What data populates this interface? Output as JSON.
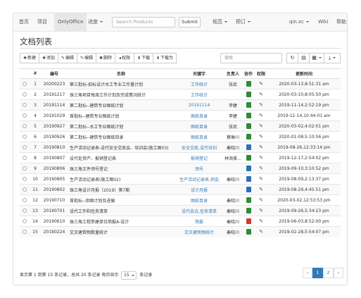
{
  "navbar": {
    "items": [
      {
        "label": "首页",
        "dropdown": false
      },
      {
        "label": "项目",
        "dropdown": false
      },
      {
        "label": "OnlyOffice",
        "dropdown": false,
        "active": true
      },
      {
        "label": "进度",
        "dropdown": true
      }
    ],
    "search_placeholder": "Search Products",
    "submit_label": "Submit",
    "right_items": [
      {
        "label": "规范",
        "dropdown": true
      },
      {
        "label": "预订",
        "dropdown": true
      },
      {
        "label": "qin.xc",
        "dropdown": true
      },
      {
        "label": "Wiki",
        "dropdown": false
      },
      {
        "label": "帮助",
        "dropdown": false
      }
    ]
  },
  "page": {
    "title": "文档列表"
  },
  "toolbar": {
    "buttons": [
      {
        "icon": "plus-icon",
        "glyph": "✚",
        "label": "新建"
      },
      {
        "icon": "plus-icon",
        "glyph": "✚",
        "label": "添加"
      },
      {
        "icon": "edit-icon",
        "glyph": "✎",
        "label": "编辑"
      },
      {
        "icon": "edit-icon",
        "glyph": "✎",
        "label": "编辑"
      },
      {
        "icon": "trash-icon",
        "glyph": "✖",
        "label": "删除"
      },
      {
        "icon": "share-icon",
        "glyph": "◂",
        "label": "权限"
      },
      {
        "icon": "download-icon",
        "glyph": "⬇",
        "label": "下载"
      },
      {
        "icon": "download-icon",
        "glyph": "⬇",
        "label": "下载为"
      }
    ],
    "filter_placeholder": "搜索",
    "right_buttons": [
      {
        "icon": "refresh-icon",
        "glyph": "↻"
      },
      {
        "icon": "columns-icon",
        "glyph": "▤"
      },
      {
        "icon": "grid-icon",
        "glyph": "▦",
        "dropdown": true
      },
      {
        "icon": "export-icon",
        "glyph": "⤓",
        "dropdown": true
      }
    ]
  },
  "table": {
    "headers": [
      "",
      "#",
      "编号",
      "名称",
      "关键字",
      "负责人",
      "协作",
      "权限",
      "更新时间"
    ],
    "rows": [
      {
        "index": "1",
        "code": "20200223",
        "name": "第三批标-招标设计水工专业工作量计划",
        "keyword": "工作统计",
        "owner": "张武",
        "filetype": "excel",
        "updated": "2020-03-13,8:51:31 am"
      },
      {
        "index": "2",
        "code": "20191217",
        "name": "珠三角项目每周工作计划及完成情况统计",
        "keyword": "工作统计",
        "owner": "",
        "filetype": "excel",
        "updated": "2020-03-10,8:05:50 pm"
      },
      {
        "index": "3",
        "code": "20191114",
        "name": "第二批标--建筑专业图纸计划",
        "keyword": "20191114",
        "owner": "李婕",
        "filetype": "excel",
        "updated": "2019-11-14,2:52:19 pm"
      },
      {
        "index": "4",
        "code": "20191029",
        "name": "首批标--建筑专业图纸计划",
        "keyword": "图纸目录",
        "owner": "李婕",
        "filetype": "excel",
        "updated": "2019-11-14,10:44:01 am"
      },
      {
        "index": "5",
        "code": "20190927",
        "name": "第二批标--水工专业图纸计划",
        "keyword": "图纸目录",
        "owner": "张武",
        "filetype": "excel",
        "updated": "2020-03-02,4:02:01 pm"
      },
      {
        "index": "6",
        "code": "20190926",
        "name": "第二批标--建筑专业图纸目录",
        "keyword": "图纸目录",
        "owner": "蔡琳川",
        "filetype": "excel",
        "updated": "2020-01-08,5:10:56 pm"
      },
      {
        "index": "7",
        "code": "20190810",
        "name": "生产活动记录表-设代安全交底会、培训会(施工图03)",
        "keyword": "安全交底,设代培训",
        "owner": "秦晓川",
        "filetype": "word",
        "updated": "2019-08-26,12:33:14 pm"
      },
      {
        "index": "8",
        "code": "20190807",
        "name": "设代处资产、报销登记表",
        "keyword": "报销登记",
        "owner": "林海美...",
        "filetype": "excel",
        "updated": "2019-12-17,2:54:02 pm"
      },
      {
        "index": "9",
        "code": "20190806",
        "name": "珠三角文件领号登记",
        "keyword": "领号",
        "owner": "",
        "filetype": "word",
        "updated": "2019-09-10,3:10:52 pm"
      },
      {
        "index": "10",
        "code": "20190805",
        "name": "生产活动记录表(施工图02)",
        "keyword": "生产活动记录表,例会",
        "owner": "秦晓川",
        "filetype": "word",
        "updated": "2019-08-09,2:13:37 pm"
      },
      {
        "index": "11",
        "code": "20190802",
        "name": "珠三角设计月报（2019）第7期",
        "keyword": "设计月报",
        "owner": "",
        "filetype": "word",
        "updated": "2019-08-29,4:45:51 pm"
      },
      {
        "index": "12",
        "code": "20190710",
        "name": "首批标--供图计划及进展",
        "keyword": "图纸目录",
        "owner": "秦晓川",
        "filetype": "excel",
        "updated": "2020-03-02,12:53:53 pm"
      },
      {
        "index": "13",
        "code": "20190701",
        "name": "设代工作和任务清单",
        "keyword": "设代会议,任务清单",
        "owner": "秦晓川",
        "filetype": "excel",
        "updated": "2019-09-26,5:34:23 pm"
      },
      {
        "index": "14",
        "code": "20190610",
        "name": "珠三角工程参建单位简报A-设计",
        "keyword": "简报",
        "owner": "秦晓川",
        "filetype": "pdf",
        "updated": "2019-06-03,8:52:00 pm"
      },
      {
        "index": "15",
        "code": "20190224",
        "name": "交叉建筑物数量统计",
        "keyword": "交叉建筑物统计",
        "owner": "秦晓川",
        "filetype": "excel",
        "updated": "2019-02-28,5:54:07 pm"
      }
    ]
  },
  "footer": {
    "info_prefix": "显示第 1 到第 15 条记录，总共 20 条记录 每页显示",
    "page_size": "15",
    "info_suffix": "条记录",
    "pages": [
      "‹",
      "1",
      "2",
      "›"
    ]
  },
  "colors": {
    "link": "#337ab7",
    "excel": "#2e8b3a",
    "word": "#2f6ebd",
    "pdf": "#d23a2a"
  }
}
